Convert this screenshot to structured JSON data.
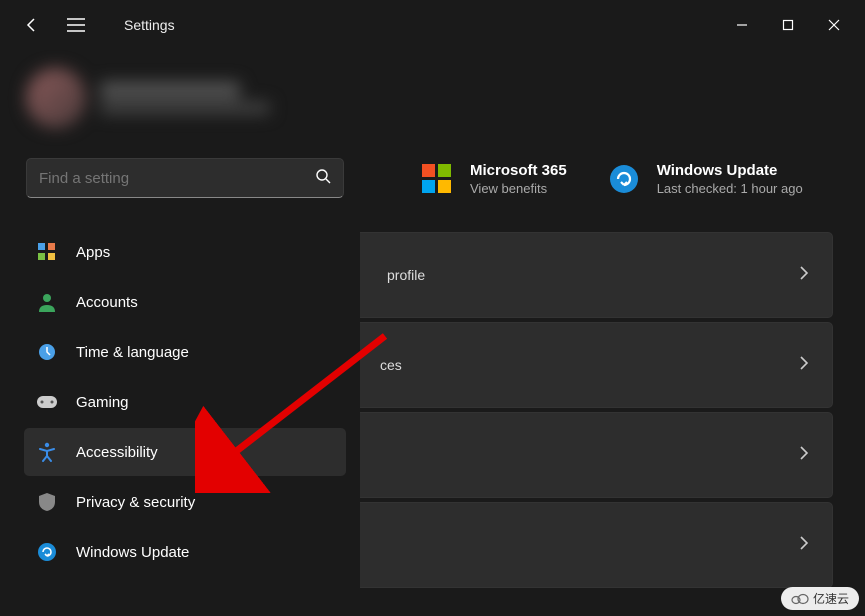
{
  "titlebar": {
    "title": "Settings"
  },
  "search": {
    "placeholder": "Find a setting"
  },
  "sidebar": {
    "items": [
      {
        "label": "Apps",
        "icon": "apps-icon"
      },
      {
        "label": "Accounts",
        "icon": "accounts-icon"
      },
      {
        "label": "Time & language",
        "icon": "time-language-icon"
      },
      {
        "label": "Gaming",
        "icon": "gaming-icon"
      },
      {
        "label": "Accessibility",
        "icon": "accessibility-icon",
        "selected": true
      },
      {
        "label": "Privacy & security",
        "icon": "privacy-icon"
      },
      {
        "label": "Windows Update",
        "icon": "update-icon"
      }
    ]
  },
  "promos": {
    "m365": {
      "title": "Microsoft 365",
      "subtitle": "View benefits"
    },
    "update": {
      "title": "Windows Update",
      "subtitle": "Last checked: 1 hour ago"
    }
  },
  "cards": {
    "c1": "profile",
    "c2": "ces"
  },
  "watermark": "亿速云"
}
